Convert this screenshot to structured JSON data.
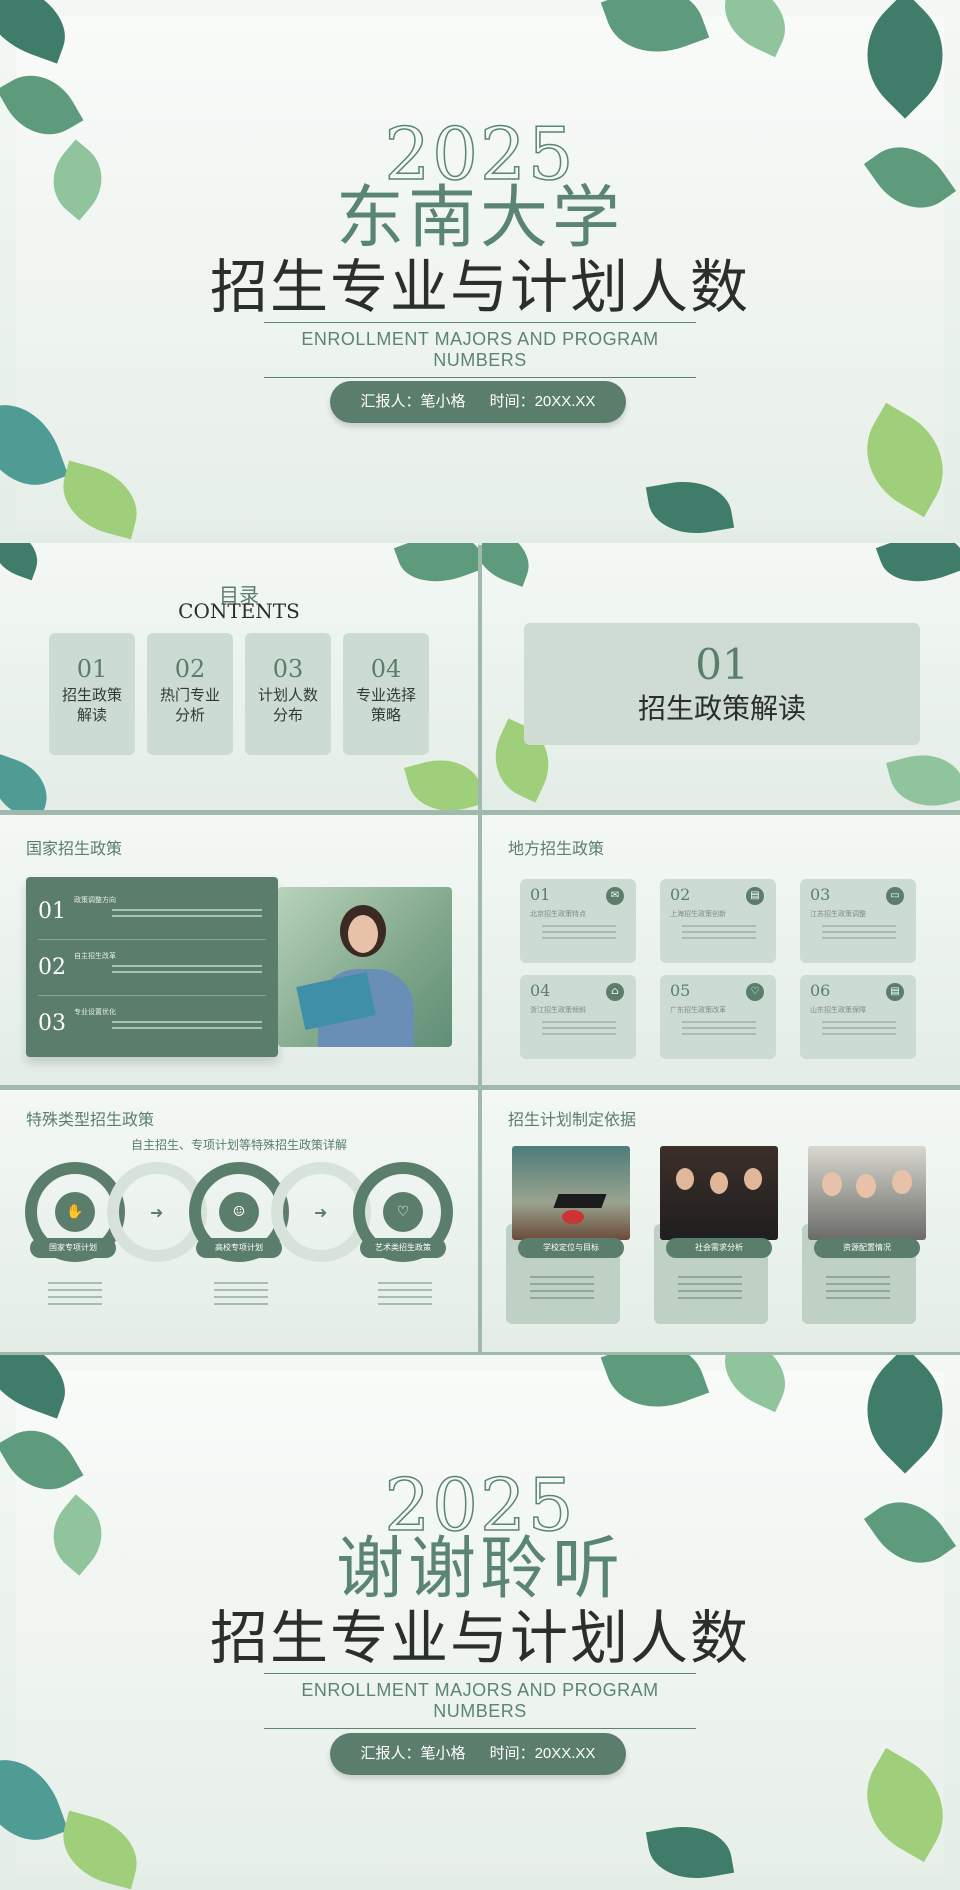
{
  "cover": {
    "year": "2025",
    "school": "东南大学",
    "title": "招生专业与计划人数",
    "subtitle_en": "ENROLLMENT MAJORS AND PROGRAM NUMBERS",
    "reporter": "汇报人：笔小格",
    "time": "时间：20XX.XX"
  },
  "contents": {
    "title_cn": "目录",
    "title_en": "CONTENTS",
    "items": [
      {
        "num": "01",
        "label": "招生政策解读"
      },
      {
        "num": "02",
        "label": "热门专业分析"
      },
      {
        "num": "03",
        "label": "计划人数分布"
      },
      {
        "num": "04",
        "label": "专业选择策略"
      }
    ]
  },
  "section01": {
    "num": "01",
    "title": "招生政策解读"
  },
  "national": {
    "title": "国家招生政策",
    "rows": [
      {
        "num": "01",
        "head": "政策调整方向"
      },
      {
        "num": "02",
        "head": "自主招生改革"
      },
      {
        "num": "03",
        "head": "专业设置优化"
      }
    ]
  },
  "local": {
    "title": "地方招生政策",
    "cards": [
      {
        "num": "01",
        "head": "北京招生政策特点",
        "icon": "chat-icon"
      },
      {
        "num": "02",
        "head": "上海招生政策创新",
        "icon": "doc-icon"
      },
      {
        "num": "03",
        "head": "江苏招生政策调整",
        "icon": "screen-icon"
      },
      {
        "num": "04",
        "head": "浙江招生政策倾斜",
        "icon": "home-icon"
      },
      {
        "num": "05",
        "head": "广东招生政策改革",
        "icon": "heart-icon"
      },
      {
        "num": "06",
        "head": "山东招生政策保障",
        "icon": "doc-icon"
      }
    ]
  },
  "special": {
    "title": "特殊类型招生政策",
    "subtitle": "自主招生、专项计划等特殊招生政策详解",
    "items": [
      {
        "label": "国家专项计划",
        "icon": "hand-icon"
      },
      {
        "label": "高校专项计划",
        "icon": "user-icon"
      },
      {
        "label": "艺术类招生政策",
        "icon": "heart-icon"
      }
    ]
  },
  "basis": {
    "title": "招生计划制定依据",
    "items": [
      {
        "label": "学校定位与目标"
      },
      {
        "label": "社会需求分析"
      },
      {
        "label": "资源配置情况"
      }
    ]
  },
  "thanks": {
    "year": "2025",
    "title1": "谢谢聆听",
    "title2": "招生专业与计划人数",
    "subtitle_en": "ENROLLMENT MAJORS AND PROGRAM NUMBERS",
    "reporter": "汇报人：笔小格",
    "time": "时间：20XX.XX"
  },
  "colors": {
    "accent": "#5b7e6c",
    "card": "#cddcd3",
    "frame": "#9fb9ad"
  }
}
